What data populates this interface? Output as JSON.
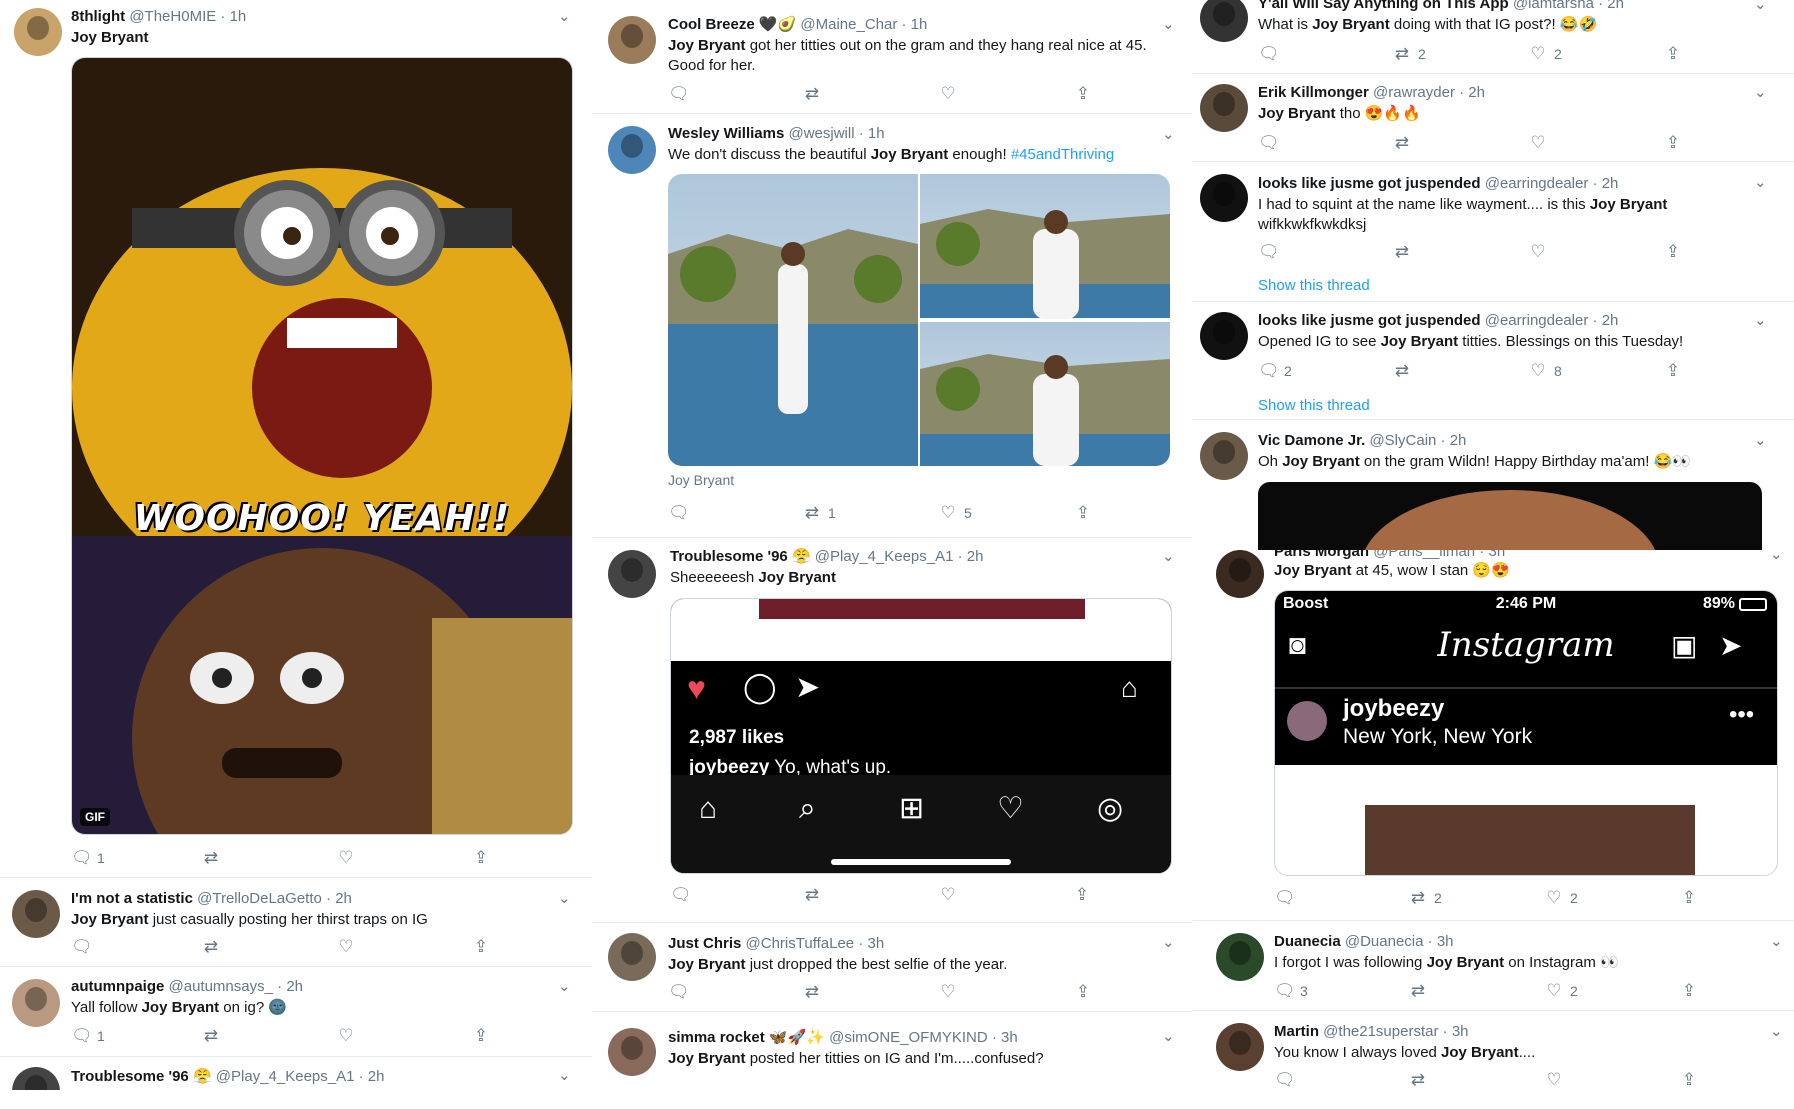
{
  "tweets": {
    "t1": {
      "name": "8thlight",
      "handle": "@TheH0MIE",
      "time": "1h",
      "text_bold": "Joy Bryant",
      "text": "",
      "gif_text": "WOOHOO! YEAH!!",
      "gif_badge": "GIF",
      "replies": "1",
      "retweets": "",
      "likes": ""
    },
    "t2": {
      "name": "I'm not a statistic",
      "handle": "@TrelloDeLaGetto",
      "time": "2h",
      "text_bold": "Joy Bryant",
      "text": " just casually posting her thirst traps on IG"
    },
    "t3": {
      "name": "autumnpaige",
      "handle": "@autumnsays_",
      "time": "2h",
      "text_pre": "Yall follow ",
      "text_bold": "Joy Bryant",
      "text": " on ig? 🌚",
      "replies": "1"
    },
    "t4": {
      "name": "Troublesome '96 😤",
      "handle": "@Play_4_Keeps_A1",
      "time": "2h"
    },
    "t5": {
      "name": "Cool Breeze 🖤🥑",
      "handle": "@Maine_Char",
      "time": "1h",
      "text_bold": "Joy Bryant",
      "text": " got her titties out on the gram and they hang real nice at 45.",
      "text2": "Good for her."
    },
    "t6": {
      "name": "Wesley Williams",
      "handle": "@wesjwill",
      "time": "1h",
      "text_pre": "We don't discuss the beautiful ",
      "text_bold": "Joy Bryant",
      "text": " enough! ",
      "hashtag": "#45andThriving",
      "caption": "Joy Bryant",
      "retweets": "1",
      "likes": "5"
    },
    "t7": {
      "name": "Troublesome '96 😤",
      "handle": "@Play_4_Keeps_A1",
      "time": "2h",
      "text": "Sheeeeeesh ",
      "text_bold": "Joy Bryant",
      "ig_likes": "2,987 likes",
      "ig_caption_user": "joybeezy",
      "ig_caption": " Yo, what's up."
    },
    "t8": {
      "name": "Just Chris",
      "handle": "@ChrisTuffaLee",
      "time": "3h",
      "text_bold": "Joy Bryant",
      "text": " just dropped the best selfie of the year."
    },
    "t9": {
      "name": "simma rocket 🦋🚀✨",
      "handle": "@simONE_OFMYKIND",
      "time": "3h",
      "text_bold": "Joy Bryant",
      "text": " posted her titties on IG and I'm.....confused?"
    },
    "t10": {
      "name": "Y'all Will Say Anything on This App",
      "handle": "@iamtarsha",
      "time": "2h",
      "text_pre": "What is ",
      "text_bold": "Joy Bryant",
      "text": " doing with that IG post?! 😂🤣",
      "retweets": "2",
      "likes": "2"
    },
    "t11": {
      "name": "Erik Killmonger",
      "handle": "@rawrayder",
      "time": "2h",
      "text_bold": "Joy Bryant",
      "text": " tho 😍🔥🔥"
    },
    "t12": {
      "name": "looks like jusme got juspended",
      "handle": "@earringdealer",
      "time": "2h",
      "text": "I had to squint at the name like wayment.... is this ",
      "text_bold": "Joy Bryant",
      "text2": "wifkkwkfkwkdksj",
      "thread": "Show this thread"
    },
    "t13": {
      "name": "looks like jusme got juspended",
      "handle": "@earringdealer",
      "time": "2h",
      "text_pre": "Opened IG to see ",
      "text_bold": "Joy Bryant",
      "text": " titties. Blessings on this Tuesday!",
      "replies": "2",
      "likes": "8",
      "thread": "Show this thread"
    },
    "t14": {
      "name": "Vic Damone Jr.",
      "handle": "@SlyCain",
      "time": "2h",
      "text_pre": "Oh ",
      "text_bold": "Joy Bryant",
      "text": " on the gram Wildn! Happy Birthday ma'am! 😂👀"
    },
    "t15": {
      "name": "Paris Morgan",
      "handle": "@Paris__ilman",
      "time": "3h",
      "text_bold": "Joy Bryant",
      "text": " at 45, wow I stan 😌😍",
      "carrier": "Boost",
      "clock": "2:46 PM",
      "battery": "89%",
      "ig_logo": "Instagram",
      "ig_user": "joybeezy",
      "ig_location": "New York, New York",
      "retweets": "2",
      "likes": "2"
    },
    "t16": {
      "name": "Duanecia",
      "handle": "@Duanecia",
      "time": "3h",
      "text_pre": "I forgot I was following ",
      "text_bold": "Joy Bryant",
      "text": " on Instagram 👀",
      "replies": "3",
      "likes": "2"
    },
    "t17": {
      "name": "Martin",
      "handle": "@the21superstar",
      "time": "3h",
      "text_pre": "You know I always loved ",
      "text_bold": "Joy Bryant",
      "text": "...."
    }
  },
  "icons": {
    "reply": "reply-icon",
    "retweet": "retweet-icon",
    "like": "heart-icon",
    "share": "share-icon",
    "more": "chevron-down-icon"
  },
  "colors": {
    "link": "#1da1f2",
    "muted": "#657786",
    "border": "#e6ecf0",
    "ig_heart": "#ed4956"
  }
}
